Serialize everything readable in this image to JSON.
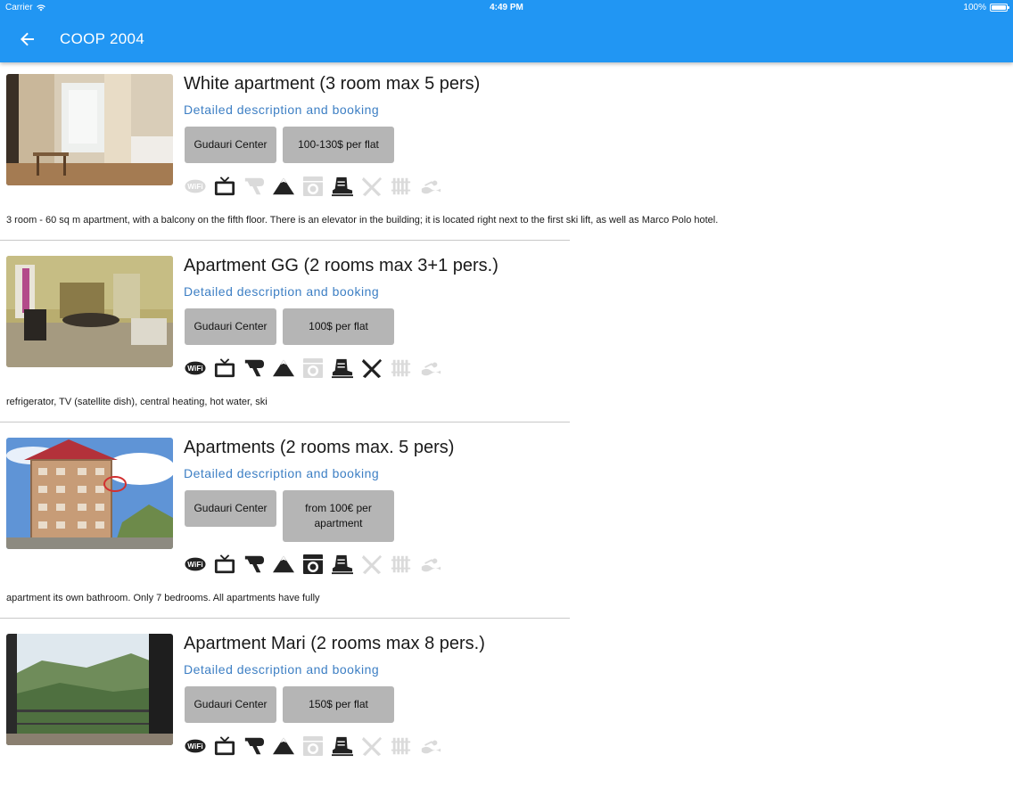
{
  "status_bar": {
    "carrier": "Carrier",
    "time": "4:49 PM",
    "battery": "100%",
    "battery_level": 1.0
  },
  "app_bar": {
    "title": "COOP 2004"
  },
  "accent_color": "#2196f3",
  "link_color": "#3d7fc4",
  "listings": [
    {
      "title": "White apartment (3 room max 5 pers)",
      "link": "Detailed description and booking",
      "location": "Gudauri Center",
      "price": "100-130$ per flat",
      "description": "3 room - 60 sq m apartment, with a balcony on the fifth floor. There is an elevator in the building; it is located right next to the first ski lift, as well as Marco Polo hotel.",
      "amenities": [
        {
          "icon": "wifi-icon",
          "available": false
        },
        {
          "icon": "tv-icon",
          "available": true
        },
        {
          "icon": "hair-dryer-icon",
          "available": false
        },
        {
          "icon": "mountain-icon",
          "available": true
        },
        {
          "icon": "washing-machine-icon",
          "available": false
        },
        {
          "icon": "ski-boot-icon",
          "available": true
        },
        {
          "icon": "kitchen-icon",
          "available": false
        },
        {
          "icon": "heating-icon",
          "available": false
        },
        {
          "icon": "sauna-icon",
          "available": false
        }
      ]
    },
    {
      "title": "Apartment GG (2 rooms max 3+1 pers.)",
      "link": "Detailed description and booking",
      "location": "Gudauri Center",
      "price": "100$ per flat",
      "description": "refrigerator, TV (satellite dish), central heating, hot water, ski",
      "amenities": [
        {
          "icon": "wifi-icon",
          "available": true
        },
        {
          "icon": "tv-icon",
          "available": true
        },
        {
          "icon": "hair-dryer-icon",
          "available": true
        },
        {
          "icon": "mountain-icon",
          "available": true
        },
        {
          "icon": "washing-machine-icon",
          "available": false
        },
        {
          "icon": "ski-boot-icon",
          "available": true
        },
        {
          "icon": "kitchen-icon",
          "available": true
        },
        {
          "icon": "heating-icon",
          "available": false
        },
        {
          "icon": "sauna-icon",
          "available": false
        }
      ]
    },
    {
      "title": "Apartments (2 rooms max. 5 pers)",
      "link": "Detailed description and booking",
      "location": "Gudauri Center",
      "price": "from 100€ per apartment",
      "description": "apartment its own bathroom. Only 7 bedrooms. All apartments have fully",
      "amenities": [
        {
          "icon": "wifi-icon",
          "available": true
        },
        {
          "icon": "tv-icon",
          "available": true
        },
        {
          "icon": "hair-dryer-icon",
          "available": true
        },
        {
          "icon": "mountain-icon",
          "available": true
        },
        {
          "icon": "washing-machine-icon",
          "available": true
        },
        {
          "icon": "ski-boot-icon",
          "available": true
        },
        {
          "icon": "kitchen-icon",
          "available": false
        },
        {
          "icon": "heating-icon",
          "available": false
        },
        {
          "icon": "sauna-icon",
          "available": false
        }
      ]
    },
    {
      "title": "Apartment Mari (2 rooms max 8 pers.)",
      "link": "Detailed description and booking",
      "location": "Gudauri Center",
      "price": "150$ per flat",
      "description": "",
      "amenities": [
        {
          "icon": "wifi-icon",
          "available": true
        },
        {
          "icon": "tv-icon",
          "available": true
        },
        {
          "icon": "hair-dryer-icon",
          "available": true
        },
        {
          "icon": "mountain-icon",
          "available": true
        },
        {
          "icon": "washing-machine-icon",
          "available": false
        },
        {
          "icon": "ski-boot-icon",
          "available": true
        },
        {
          "icon": "kitchen-icon",
          "available": false
        },
        {
          "icon": "heating-icon",
          "available": false
        },
        {
          "icon": "sauna-icon",
          "available": false
        }
      ]
    }
  ]
}
